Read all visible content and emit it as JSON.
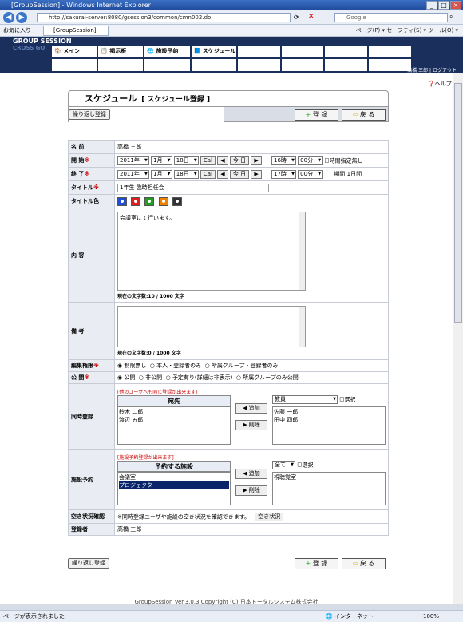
{
  "window": {
    "title": "[GroupSession] - Windows Internet Explorer"
  },
  "browser": {
    "url": "http://sakurai-server:8080/gsession3/common/cmn002.do",
    "search_placeholder": "Google",
    "fav_label": "お気に入り",
    "tab_label": "[GroupSession]",
    "tools": "ページ(P) ▾  セーフティ(S) ▾  ツール(O) ▾"
  },
  "app": {
    "logo": "GROUP SESSION",
    "logo_sub": "CROSS GO",
    "menu": [
      "メイン",
      "掲示板",
      "施設予約",
      "スケジュール"
    ],
    "user": "高橋 三郎",
    "logout": "ログアウト",
    "help": "ヘルプ"
  },
  "header": {
    "title": "スケジュール",
    "subtitle": "[ スケジュール登録 ]"
  },
  "buttons": {
    "repeat": "繰り返し登録",
    "register": "登 録",
    "back": "戻 る"
  },
  "form": {
    "name_label": "名 前",
    "name_value": "高橋 三郎",
    "start_label": "開 始",
    "end_label": "終 了",
    "start": {
      "year": "2011年",
      "month": "1月",
      "day": "18日",
      "hour": "16時",
      "min": "00分"
    },
    "end": {
      "year": "2011年",
      "month": "1月",
      "day": "18日",
      "hour": "17時",
      "min": "00分"
    },
    "cal": "Cal",
    "today": "今 日",
    "no_time": "時間指定無し",
    "duration": "期間:1日間",
    "title_label": "タイトル",
    "title_value": "1年生 臨時担任会",
    "color_label": "タイトル色",
    "colors": [
      "#1f4fd0",
      "#e02020",
      "#20a020",
      "#f08000",
      "#333333"
    ],
    "content_label": "内 容",
    "content_value": "会議室にて行います。",
    "content_count": "現在の文字数:10 / 1000 文字",
    "note_label": "備 考",
    "note_value": "",
    "note_count": "現在の文字数:0 / 1000 文字",
    "edit_label": "編集権限",
    "edit_options": [
      "制限無し",
      "本人・登録者のみ",
      "所属グループ・登録者のみ"
    ],
    "public_label": "公 開",
    "public_options": [
      "公開",
      "非公開",
      "予定有り(詳細は非表示)",
      "所属グループのみ公開"
    ],
    "same_label": "同時登録",
    "same_note": "[他のユーザへも同じ登録が出来ます]",
    "same_header": "宛先",
    "same_members": [
      "鈴木 二郎",
      "渡辺 五郎"
    ],
    "group_select": "教員",
    "select_label": "選択",
    "same_candidates": [
      "佐藤 一郎",
      "田中 四郎"
    ],
    "add": "◀ 追加",
    "remove": "▶ 削除",
    "facility_label": "施設予約",
    "facility_note": "[施設予約登録が出来ます]",
    "facility_header": "予約する施設",
    "facility_items": [
      "会議室",
      "プロジェクター"
    ],
    "facility_group": "全て",
    "facility_candidates": [
      "視聴覚室"
    ],
    "vacancy_label": "空き状況確認",
    "vacancy_note": "※同時登録ユーザや施設の空き状況を確認できます。",
    "vacancy_btn": "空き状況",
    "registrant_label": "登録者",
    "registrant_value": "高橋 三郎"
  },
  "footer": "GroupSession Ver.3.0.3 Copyright (C) 日本トータルシステム株式会社",
  "status": {
    "left": "ページが表示されました",
    "zone": "インターネット",
    "zoom": "100%"
  }
}
